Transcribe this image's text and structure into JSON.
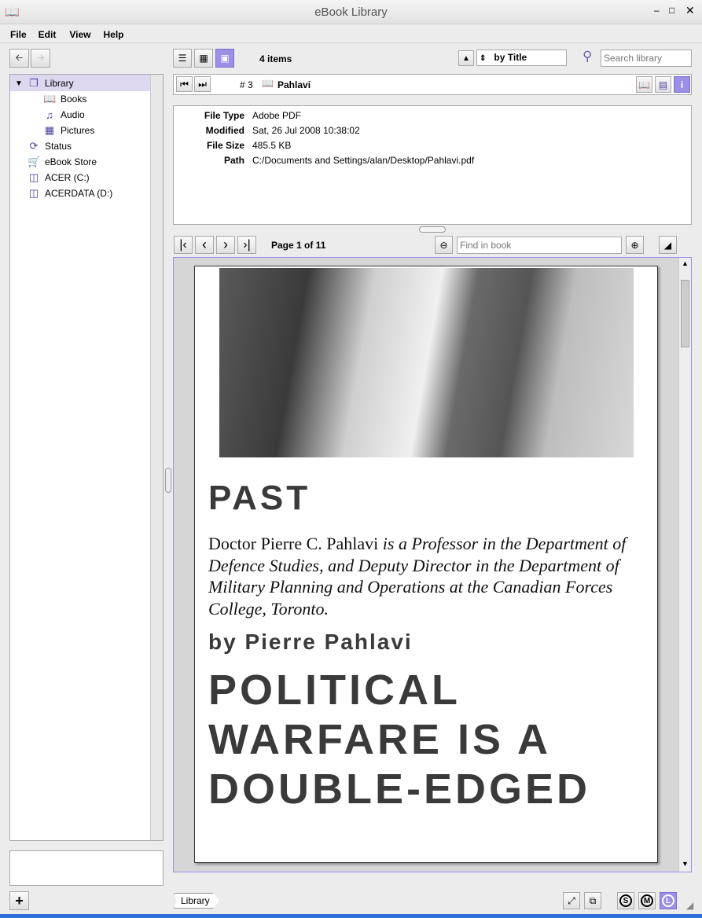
{
  "window": {
    "title": "eBook Library"
  },
  "menu": [
    "File",
    "Edit",
    "View",
    "Help"
  ],
  "toolbar": {
    "items_count": "4 items",
    "sort": "by Title",
    "search_placeholder": "Search library"
  },
  "sidebar": {
    "items": [
      {
        "label": "Library",
        "icon": "library-icon"
      },
      {
        "label": "Books",
        "icon": "book-icon"
      },
      {
        "label": "Audio",
        "icon": "music-icon"
      },
      {
        "label": "Pictures",
        "icon": "picture-icon"
      },
      {
        "label": "Status",
        "icon": "sync-icon"
      },
      {
        "label": "eBook Store",
        "icon": "cart-icon"
      },
      {
        "label": "ACER (C:)",
        "icon": "drive-icon"
      },
      {
        "label": "ACERDATA (D:)",
        "icon": "drive-icon"
      }
    ]
  },
  "item_bar": {
    "index": "# 3",
    "title": "Pahlavi"
  },
  "metadata": [
    {
      "k": "File Type",
      "v": "Adobe PDF"
    },
    {
      "k": "Modified",
      "v": "Sat, 26 Jul 2008 10:38:02"
    },
    {
      "k": "File Size",
      "v": "485.5 KB"
    },
    {
      "k": "Path",
      "v": "C:/Documents and Settings/alan/Desktop/Pahlavi.pdf"
    }
  ],
  "reader": {
    "page_label": "Page 1 of 11",
    "find_placeholder": "Find in book"
  },
  "page": {
    "heading1": "PAST",
    "bio_name": "Doctor Pierre C. Pahlavi",
    "bio_rest": " is a Professor in the Department of Defence Studies, and Deputy Director in the Department of Military Planning and Operations at the Canadian Forces College, Toronto.",
    "byline": "by Pierre Pahlavi",
    "title_lines": [
      "POLITICAL",
      "WARFARE IS A",
      "DOUBLE-EDGED"
    ]
  },
  "footer": {
    "breadcrumb": "Library",
    "size_s": "S",
    "size_m": "M",
    "size_l": "L"
  }
}
